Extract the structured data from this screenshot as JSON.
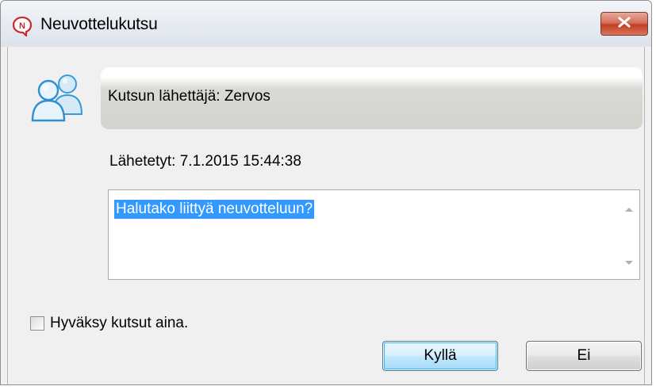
{
  "window": {
    "title": "Neuvottelukutsu"
  },
  "icons": {
    "app": "speech-bubble-n-icon",
    "close": "close-icon",
    "users": "users-icon"
  },
  "dialog": {
    "sender": "Kutsun lähettäjä: Zervos",
    "sent": "Lähetetyt: 7.1.2015 15:44:38",
    "message": "Halutako liittyä neuvotteluun?",
    "always_accept_label": "Hyväksy kutsut aina.",
    "always_accept_checked": false,
    "yes_label": "Kyllä",
    "no_label": "Ei"
  },
  "colors": {
    "selection": "#3399ff",
    "close_button": "#c8452c",
    "default_button_border": "#3c7fb1",
    "users_icon": "#2ea1e0"
  }
}
